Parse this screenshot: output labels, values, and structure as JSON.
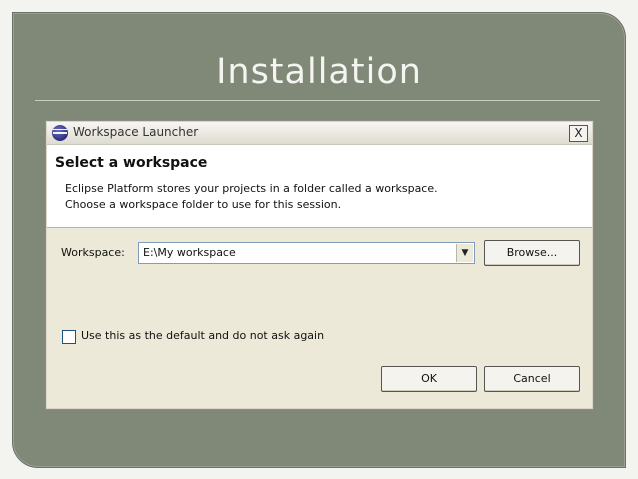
{
  "slide": {
    "title": "Installation"
  },
  "dialog": {
    "window_title": "Workspace Launcher",
    "close_symbol": "X",
    "heading": "Select a workspace",
    "description_line1": "Eclipse Platform stores your projects in a folder called a workspace.",
    "description_line2": "Choose a workspace folder to use for this session.",
    "workspace_label": "Workspace:",
    "workspace_value": "E:\\My workspace",
    "dropdown_arrow": "▼",
    "browse_label": "Browse...",
    "default_checkbox_label": "Use this as the default and do not ask again",
    "default_checked": false,
    "ok_label": "OK",
    "cancel_label": "Cancel"
  },
  "icons": [
    "eclipse-app-icon",
    "close-icon",
    "dropdown-arrow-icon",
    "checkbox-icon"
  ]
}
